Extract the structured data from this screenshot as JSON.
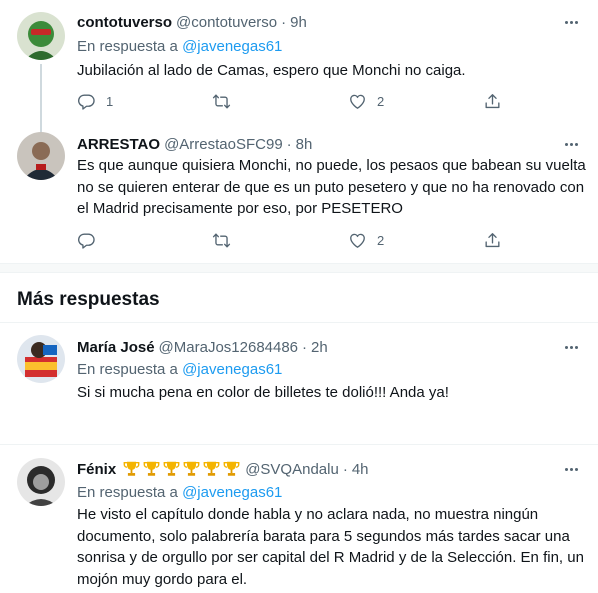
{
  "tweets": [
    {
      "name": "contotuverso",
      "handle": "@contotuverso",
      "dot": "·",
      "time": "9h",
      "reply_prefix": "En respuesta a",
      "reply_to": "@javenegas61",
      "text": "Jubilación al lado de Camas, espero que Monchi no caiga.",
      "reply_count": "1",
      "retweet_count": "",
      "like_count": "2"
    },
    {
      "name": "ARRESTAO",
      "handle": "@ArrestaoSFC99",
      "dot": "·",
      "time": "8h",
      "text": "Es que aunque quisiera Monchi, no puede, los pesaos que babean su vuelta no se quieren enterar de que es un puto pesetero y que no ha renovado con el Madrid precisamente por eso, por PESETERO",
      "reply_count": "",
      "retweet_count": "",
      "like_count": "2"
    },
    {
      "name": "María José",
      "handle": "@MaraJos12684486",
      "dot": "·",
      "time": "2h",
      "reply_prefix": "En respuesta a",
      "reply_to": "@javenegas61",
      "text": "Si si mucha pena en color de billetes te dolió!!! Anda ya!"
    },
    {
      "name": "Fénix",
      "handle": "@SVQAndalu",
      "dot": "·",
      "time": "4h",
      "reply_prefix": "En respuesta a",
      "reply_to": "@javenegas61",
      "text": "He visto el capítulo donde habla y no aclara nada, no muestra ningún documento, solo palabrería barata para 5 segundos más tardes sacar una sonrisa y de orgullo por ser capital del R Madrid y de la Selección. En fin, un mojón muy gordo para el."
    }
  ],
  "section": {
    "title": "Más respuestas"
  },
  "icons": {
    "reply": "reply-icon",
    "retweet": "retweet-icon",
    "like": "heart-icon",
    "share": "share-icon",
    "more": "more-icon",
    "trophy": "trophy-icon"
  },
  "colors": {
    "accent": "#1d9bf0",
    "secondary_text": "#536471",
    "primary_text": "#0f1419",
    "divider": "#eff3f4",
    "trophy": "#f4b400"
  }
}
